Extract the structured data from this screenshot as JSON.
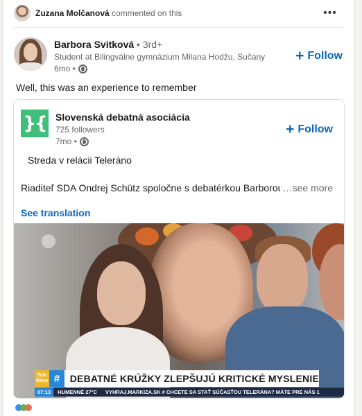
{
  "activity": {
    "actor": "Zuzana Molčanová",
    "action": " commented on this",
    "more_icon": "ellipsis-icon",
    "more_label": "•••"
  },
  "author": {
    "name": "Barbora Svitková",
    "degree": " • 3rd+",
    "headline": "Student at Bilingválne gymnázium Milana Hodžu, Sučany",
    "time": "6mo •",
    "visibility_icon": "globe-icon",
    "follow_label": "Follow"
  },
  "post": {
    "text": "Well, this was an experience to remember"
  },
  "shared": {
    "org_name": "Slovenská debatná asociácia",
    "followers": "725 followers",
    "time": "7mo •",
    "logo_mark": "}{",
    "follow_label": "Follow",
    "line1": "Streda v relácii Teleráno",
    "line2": "Riaditeľ SDA Ondrej Schütz spoločne s debatérkou Barborou",
    "see_more": "…see more",
    "see_translation": "See translation"
  },
  "media": {
    "brand_line1": "Tele",
    "brand_line2": "Ráno",
    "hash": "#",
    "headline": "DEBATNÉ KRÚŽKY ZLEPŠUJÚ KRITICKÉ MYSLENIE",
    "ticker_time": "07:13",
    "ticker_weather": "HUMENNÉ 27°C",
    "ticker_text": "VYHRAJ.MARKIZA.SK # CHCETE SA STAŤ SÚČASŤOU TELERÁNA? MÁTE PRE NÁS 1"
  },
  "colors": {
    "link_blue": "#0a66c2",
    "logo_green": "#3fbf7a"
  }
}
